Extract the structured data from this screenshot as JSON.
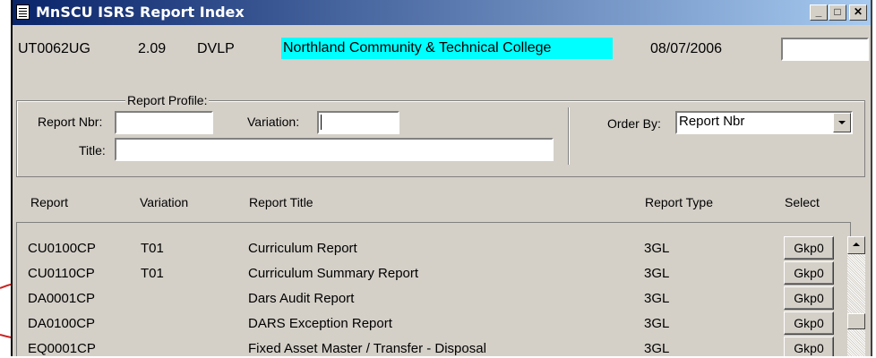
{
  "window": {
    "title": "MnSCU ISRS Report Index"
  },
  "header": {
    "report_id": "UT0062UG",
    "version": "2.09",
    "environment": "DVLP",
    "college": "Northland Community & Technical College",
    "date": "08/07/2006"
  },
  "profile": {
    "legend": "Report Profile:",
    "report_nbr_label": "Report Nbr:",
    "variation_label": "Variation:",
    "title_label": "Title:",
    "order_by_label": "Order By:",
    "order_by_value": "Report Nbr"
  },
  "columns": [
    "Report",
    "Variation",
    "Report Title",
    "Report Type",
    "Select"
  ],
  "rows": [
    {
      "report": "CU0100CP",
      "variation": "T01",
      "title": "Curriculum Report",
      "type": "3GL",
      "select": "Gkp0"
    },
    {
      "report": "CU0110CP",
      "variation": "T01",
      "title": "Curriculum Summary Report",
      "type": "3GL",
      "select": "Gkp0"
    },
    {
      "report": "DA0001CP",
      "variation": "",
      "title": "Dars Audit Report",
      "type": "3GL",
      "select": "Gkp0"
    },
    {
      "report": "DA0100CP",
      "variation": "",
      "title": "DARS Exception Report",
      "type": "3GL",
      "select": "Gkp0"
    },
    {
      "report": "EQ0001CP",
      "variation": "",
      "title": "Fixed Asset Master / Transfer - Disposal",
      "type": "3GL",
      "select": "Gkp0"
    }
  ],
  "colors": {
    "titlebar": "#0a246a",
    "college_highlight": "#00ffff",
    "annotation": "#cc2222"
  }
}
